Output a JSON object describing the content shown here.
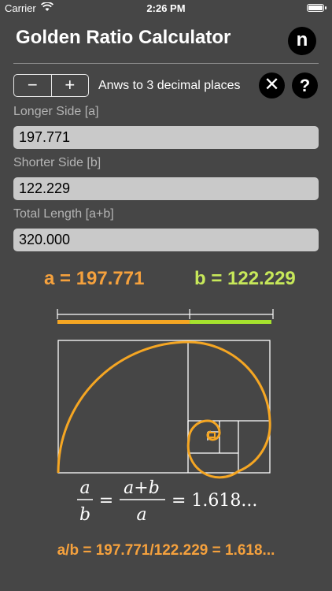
{
  "status_bar": {
    "carrier": "Carrier",
    "time": "2:26 PM"
  },
  "header": {
    "title": "Golden Ratio Calculator",
    "logo_letter": "n"
  },
  "toolbar": {
    "decrement_label": "−",
    "increment_label": "+",
    "decimal_label": "Anws to 3 decimal places",
    "clear_icon": "close-icon",
    "help_label": "?"
  },
  "fields": {
    "longer": {
      "label": "Longer Side [a]",
      "value": "197.771"
    },
    "shorter": {
      "label": "Shorter Side [b]",
      "value": "122.229"
    },
    "total": {
      "label": "Total Length [a+b]",
      "value": "320.000"
    }
  },
  "results": {
    "a_text": "a = 197.771",
    "b_text": "b = 122.229",
    "ratio_text": "a/b = 197.771/122.229 = 1.618..."
  },
  "formula": {
    "numerator_left": "a",
    "denominator_left": "b",
    "numerator_right": "a+b",
    "denominator_right": "a",
    "equals": "=",
    "result": "= 1.618..."
  },
  "segment_ratio": {
    "a": 197.771,
    "b": 122.229
  },
  "colors": {
    "background": "#464646",
    "a_color": "#f5a13d",
    "b_color": "#c7e85a",
    "field_bg": "#c9c9c9",
    "spiral": "#f5a623"
  }
}
